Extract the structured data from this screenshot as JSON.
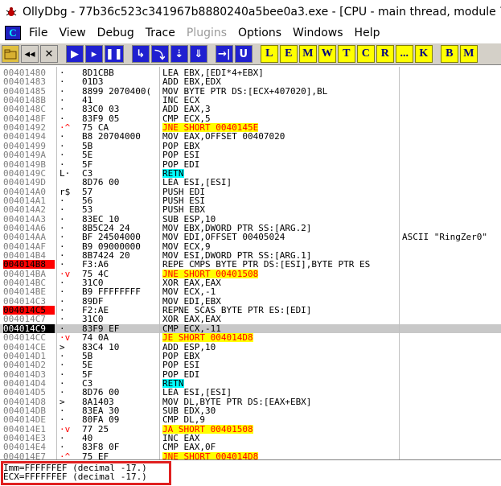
{
  "window": {
    "title": "OllyDbg - 77b36c523c341967b8880240a5bee0a3.exe - [CPU - main thread, module 77b36"
  },
  "menu": {
    "cpu_icon_label": "C",
    "items": [
      "File",
      "View",
      "Debug",
      "Trace",
      "Plugins",
      "Options",
      "Windows",
      "Help"
    ],
    "disabled": [
      "Plugins"
    ]
  },
  "toolbar": {
    "nav_buttons": [
      "◂◂",
      "✕"
    ],
    "step_buttons": [
      "▶",
      "▸",
      "❚❚"
    ],
    "trace_buttons": [
      "↳",
      "⤵",
      "⇣",
      "⇓"
    ],
    "extra_buttons": [
      "→|",
      "U"
    ],
    "window_buttons": [
      "L",
      "E",
      "M",
      "W",
      "T",
      "C",
      "R",
      "...",
      "K",
      "B",
      "M"
    ]
  },
  "disasm": {
    "rows": [
      {
        "addr": "00401480",
        "mark": "·",
        "hex": "8D1CBB",
        "asm": "LEA EBX,[EDI*4+EBX]",
        "comment": "",
        "type": "",
        "bp": false
      },
      {
        "addr": "00401483",
        "mark": "·",
        "hex": "01D3",
        "asm": "ADD EBX,EDX",
        "comment": "",
        "type": "",
        "bp": false
      },
      {
        "addr": "00401485",
        "mark": "·",
        "hex": "8899 2070400(",
        "asm": "MOV BYTE PTR DS:[ECX+407020],BL",
        "comment": "",
        "type": "",
        "bp": false
      },
      {
        "addr": "0040148B",
        "mark": "·",
        "hex": "41",
        "asm": "INC ECX",
        "comment": "",
        "type": "",
        "bp": false
      },
      {
        "addr": "0040148C",
        "mark": "·",
        "hex": "83C0 03",
        "asm": "ADD EAX,3",
        "comment": "",
        "type": "",
        "bp": false
      },
      {
        "addr": "0040148F",
        "mark": "·",
        "hex": "83F9 05",
        "asm": "CMP ECX,5",
        "comment": "",
        "type": "",
        "bp": false
      },
      {
        "addr": "00401492",
        "mark": "·^",
        "hex": "75 CA",
        "asm": "JNE SHORT 0040145E",
        "comment": "",
        "type": "jump",
        "bp": false
      },
      {
        "addr": "00401494",
        "mark": "·",
        "hex": "B8 20704000",
        "asm": "MOV EAX,OFFSET 00407020",
        "comment": "",
        "type": "",
        "bp": false
      },
      {
        "addr": "00401499",
        "mark": "·",
        "hex": "5B",
        "asm": "POP EBX",
        "comment": "",
        "type": "",
        "bp": false
      },
      {
        "addr": "0040149A",
        "mark": "·",
        "hex": "5E",
        "asm": "POP ESI",
        "comment": "",
        "type": "",
        "bp": false
      },
      {
        "addr": "0040149B",
        "mark": "·",
        "hex": "5F",
        "asm": "POP EDI",
        "comment": "",
        "type": "",
        "bp": false
      },
      {
        "addr": "0040149C",
        "mark": "L·",
        "hex": "C3",
        "asm": "RETN",
        "comment": "",
        "type": "ret",
        "bp": false
      },
      {
        "addr": "0040149D",
        "mark": "",
        "hex": "8D76 00",
        "asm": "LEA ESI,[ESI]",
        "comment": "",
        "type": "",
        "bp": false
      },
      {
        "addr": "004014A0",
        "mark": "r$",
        "hex": "57",
        "asm": "PUSH EDI",
        "comment": "",
        "type": "",
        "bp": false
      },
      {
        "addr": "004014A1",
        "mark": "·",
        "hex": "56",
        "asm": "PUSH ESI",
        "comment": "",
        "type": "",
        "bp": false
      },
      {
        "addr": "004014A2",
        "mark": "·",
        "hex": "53",
        "asm": "PUSH EBX",
        "comment": "",
        "type": "",
        "bp": false
      },
      {
        "addr": "004014A3",
        "mark": "·",
        "hex": "83EC 10",
        "asm": "SUB ESP,10",
        "comment": "",
        "type": "",
        "bp": false
      },
      {
        "addr": "004014A6",
        "mark": "·",
        "hex": "8B5C24 24",
        "asm": "MOV EBX,DWORD PTR SS:[ARG.2]",
        "comment": "",
        "type": "",
        "bp": false
      },
      {
        "addr": "004014AA",
        "mark": "·",
        "hex": "BF 24504000",
        "asm": "MOV EDI,OFFSET 00405024",
        "comment": "ASCII \"RingZer0\"",
        "type": "",
        "bp": false
      },
      {
        "addr": "004014AF",
        "mark": "·",
        "hex": "B9 09000000",
        "asm": "MOV ECX,9",
        "comment": "",
        "type": "",
        "bp": false
      },
      {
        "addr": "004014B4",
        "mark": "·",
        "hex": "8B7424 20",
        "asm": "MOV ESI,DWORD PTR SS:[ARG.1]",
        "comment": "",
        "type": "",
        "bp": false
      },
      {
        "addr": "004014B8",
        "mark": "·",
        "hex": "F3:A6",
        "asm": "REPE CMPS BYTE PTR DS:[ESI],BYTE PTR ES",
        "comment": "",
        "type": "",
        "bp": true
      },
      {
        "addr": "004014BA",
        "mark": "·v",
        "hex": "75 4C",
        "asm": "JNE SHORT 00401508",
        "comment": "",
        "type": "jump",
        "bp": false
      },
      {
        "addr": "004014BC",
        "mark": "·",
        "hex": "31C0",
        "asm": "XOR EAX,EAX",
        "comment": "",
        "type": "",
        "bp": false
      },
      {
        "addr": "004014BE",
        "mark": "·",
        "hex": "B9 FFFFFFFF",
        "asm": "MOV ECX,-1",
        "comment": "",
        "type": "",
        "bp": false
      },
      {
        "addr": "004014C3",
        "mark": "·",
        "hex": "89DF",
        "asm": "MOV EDI,EBX",
        "comment": "",
        "type": "",
        "bp": false
      },
      {
        "addr": "004014C5",
        "mark": "·",
        "hex": "F2:AE",
        "asm": "REPNE SCAS BYTE PTR ES:[EDI]",
        "comment": "",
        "type": "",
        "bp": true
      },
      {
        "addr": "004014C7",
        "mark": "·",
        "hex": "31C0",
        "asm": "XOR EAX,EAX",
        "comment": "",
        "type": "",
        "bp": false
      },
      {
        "addr": "004014C9",
        "mark": "·",
        "hex": "83F9 EF",
        "asm": "CMP ECX,-11",
        "comment": "",
        "type": "selected",
        "bp": false
      },
      {
        "addr": "004014CC",
        "mark": "·v",
        "hex": "74 0A",
        "asm": "JE SHORT 004014D8",
        "comment": "",
        "type": "jump",
        "bp": false
      },
      {
        "addr": "004014CE",
        "mark": ">",
        "hex": "83C4 10",
        "asm": "ADD ESP,10",
        "comment": "",
        "type": "",
        "bp": false
      },
      {
        "addr": "004014D1",
        "mark": "·",
        "hex": "5B",
        "asm": "POP EBX",
        "comment": "",
        "type": "",
        "bp": false
      },
      {
        "addr": "004014D2",
        "mark": "·",
        "hex": "5E",
        "asm": "POP ESI",
        "comment": "",
        "type": "",
        "bp": false
      },
      {
        "addr": "004014D3",
        "mark": "·",
        "hex": "5F",
        "asm": "POP EDI",
        "comment": "",
        "type": "",
        "bp": false
      },
      {
        "addr": "004014D4",
        "mark": "·",
        "hex": "C3",
        "asm": "RETN",
        "comment": "",
        "type": "ret",
        "bp": false
      },
      {
        "addr": "004014D5",
        "mark": "·",
        "hex": "8D76 00",
        "asm": "LEA ESI,[ESI]",
        "comment": "",
        "type": "",
        "bp": false
      },
      {
        "addr": "004014D8",
        "mark": ">",
        "hex": "8A1403",
        "asm": "MOV DL,BYTE PTR DS:[EAX+EBX]",
        "comment": "",
        "type": "",
        "bp": false
      },
      {
        "addr": "004014DB",
        "mark": "·",
        "hex": "83EA 30",
        "asm": "SUB EDX,30",
        "comment": "",
        "type": "",
        "bp": false
      },
      {
        "addr": "004014DE",
        "mark": "·",
        "hex": "80FA 09",
        "asm": "CMP DL,9",
        "comment": "",
        "type": "",
        "bp": false
      },
      {
        "addr": "004014E1",
        "mark": "·v",
        "hex": "77 25",
        "asm": "JA SHORT 00401508",
        "comment": "",
        "type": "jump",
        "bp": false
      },
      {
        "addr": "004014E3",
        "mark": "·",
        "hex": "40",
        "asm": "INC EAX",
        "comment": "",
        "type": "",
        "bp": false
      },
      {
        "addr": "004014E4",
        "mark": "·",
        "hex": "83F8 0F",
        "asm": "CMP EAX,0F",
        "comment": "",
        "type": "",
        "bp": false
      },
      {
        "addr": "004014E7",
        "mark": "·^",
        "hex": "75 EF",
        "asm": "JNE SHORT 004014D8",
        "comment": "",
        "type": "jump",
        "bp": false
      }
    ]
  },
  "info": {
    "line1": "Imm=FFFFFFEF (decimal -17.)",
    "line2": "ECX=FFFFFFEF (decimal -17.)"
  },
  "colors": {
    "jump_bg": "#ffff00",
    "jump_fg": "#ff0000",
    "ret_bg": "#00ffff",
    "breakpoint": "#ff0000",
    "highlight_box": "#e02020"
  }
}
